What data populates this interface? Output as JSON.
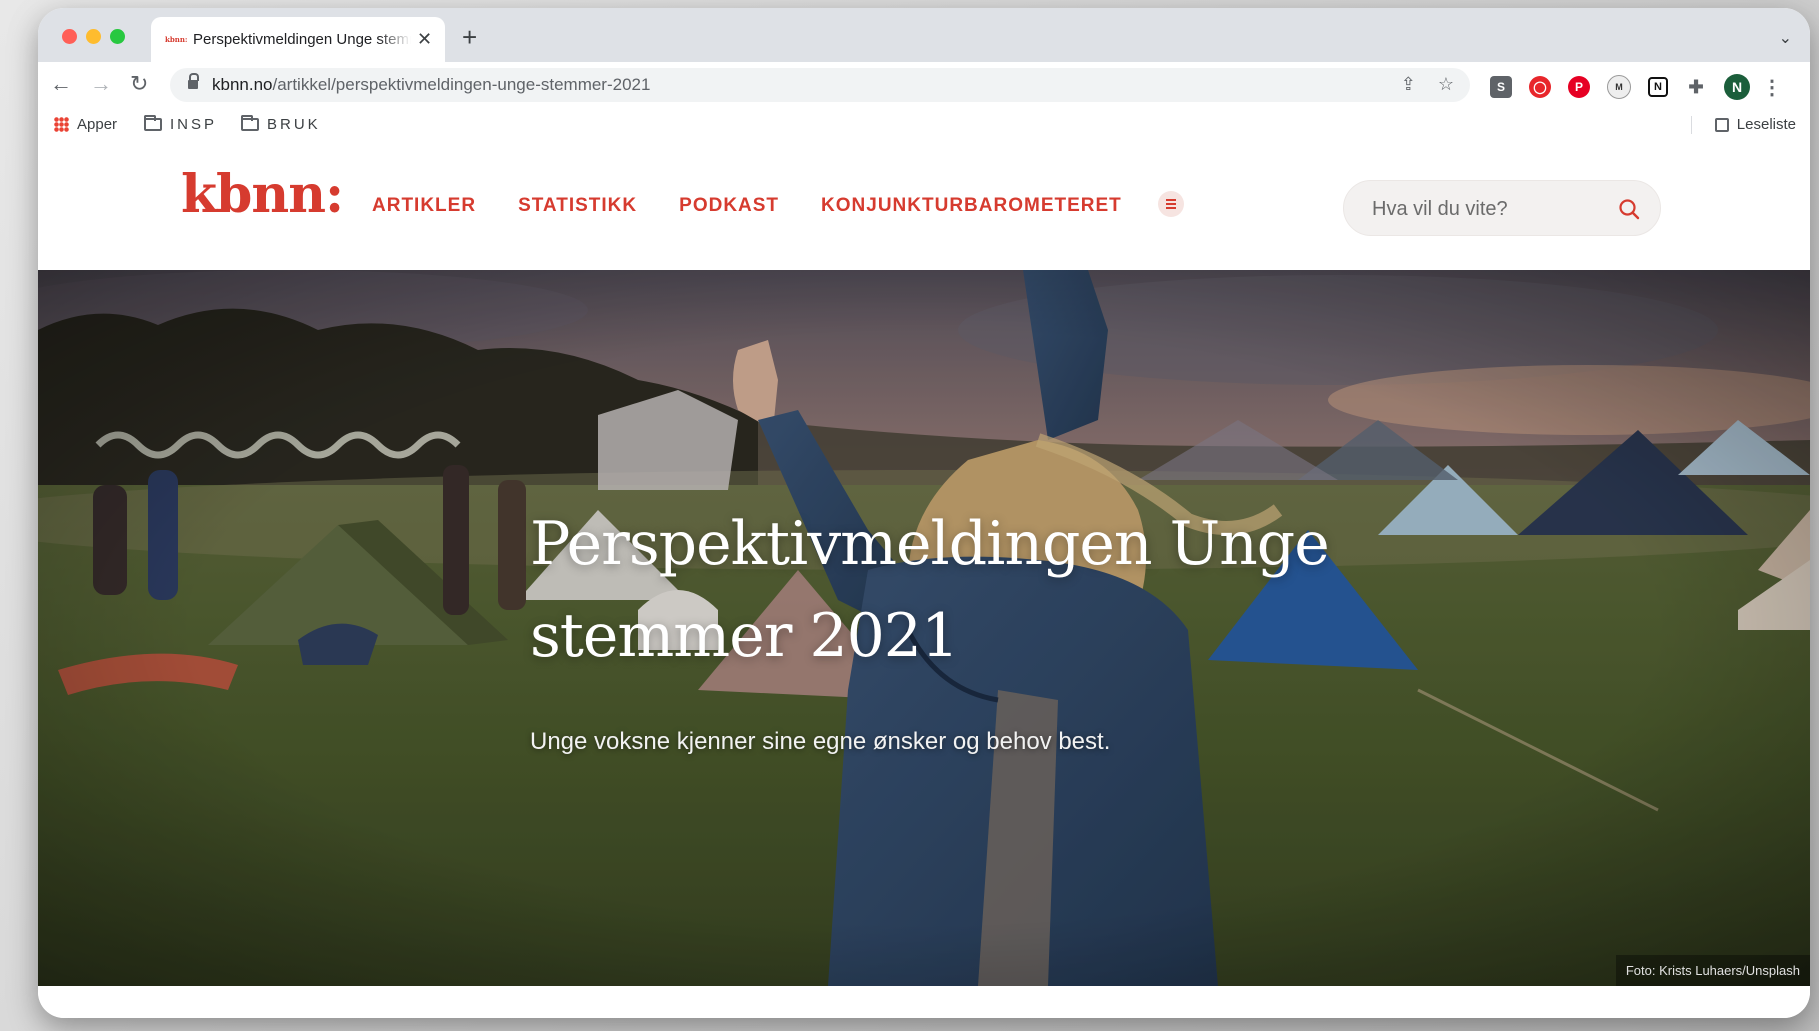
{
  "browser": {
    "tab": {
      "favicon_text": "kbnn:",
      "title": "Perspektivmeldingen Unge stemmer 2021",
      "close": "✕"
    },
    "new_tab": "+",
    "url_host": "kbnn.no",
    "url_path": "/artikkel/perspektivmeldingen-unge-stemmer-2021",
    "bookmarks": [
      {
        "label": "Apper"
      },
      {
        "label": "INSP"
      },
      {
        "label": "BRUK"
      }
    ],
    "reading_list": "Leseliste",
    "extensions": {
      "s": "S",
      "avatar": "N",
      "m": "M",
      "n": "N"
    }
  },
  "site": {
    "logo": "kbnn:",
    "nav": [
      "ARTIKLER",
      "STATISTIKK",
      "PODKAST",
      "KONJUNKTURBAROMETERET"
    ],
    "search_placeholder": "Hva vil du vite?",
    "accent": "#d63b2f"
  },
  "hero": {
    "title": "Perspektivmeldingen Unge stemmer 2021",
    "subtitle": "Unge voksne kjenner sine egne ønsker og behov best.",
    "photo_credit": "Foto: Krists Luhaers/Unsplash"
  }
}
